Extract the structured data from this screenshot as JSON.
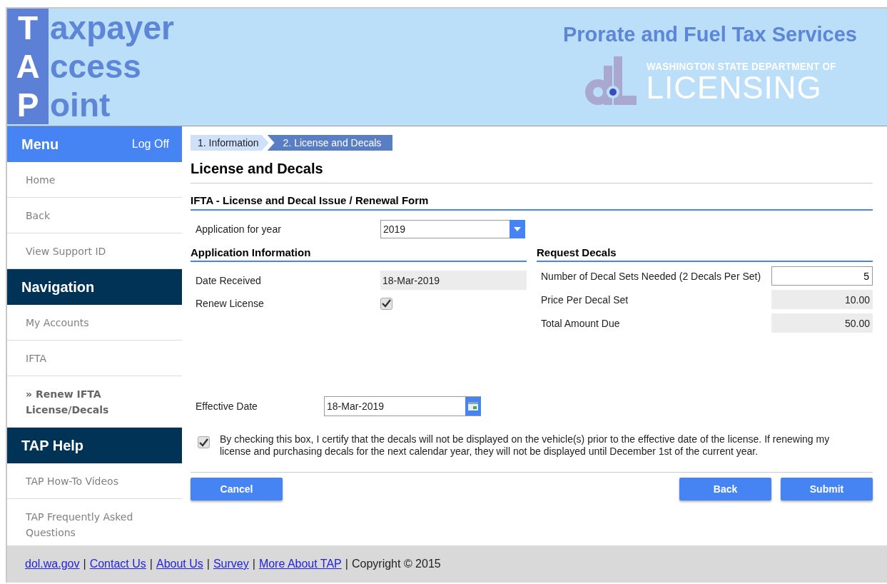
{
  "header": {
    "logo_lines": [
      {
        "initial": "T",
        "rest": "axpayer"
      },
      {
        "initial": "A",
        "rest": "ccess"
      },
      {
        "initial": "P",
        "rest": "oint"
      }
    ],
    "service_title": "Prorate and Fuel Tax Services",
    "agency_line": "WASHINGTON STATE DEPARTMENT OF",
    "agency_name": "LICENSING"
  },
  "sidebar": {
    "items": [
      {
        "kind": "header",
        "label": "Menu",
        "link": "Log Off"
      },
      {
        "kind": "item",
        "label": "Home",
        "selected": false
      },
      {
        "kind": "item",
        "label": "Back",
        "selected": false
      },
      {
        "kind": "item",
        "label": "View Support ID",
        "selected": false
      },
      {
        "kind": "section",
        "label": "Navigation"
      },
      {
        "kind": "item",
        "label": "My Accounts",
        "selected": false
      },
      {
        "kind": "item",
        "label": "IFTA",
        "selected": false
      },
      {
        "kind": "item",
        "label": "» Renew IFTA License/Decals",
        "selected": true
      },
      {
        "kind": "section",
        "label": "TAP Help"
      },
      {
        "kind": "item",
        "label": "TAP How-To Videos",
        "selected": false
      },
      {
        "kind": "item",
        "label": "TAP Frequently Asked Questions",
        "selected": false
      }
    ]
  },
  "steps": [
    {
      "label": "1. Information",
      "selected": false
    },
    {
      "label": "2. License and Decals",
      "selected": true
    }
  ],
  "page_title": "License and Decals",
  "form_title": "IFTA - License and Decal Issue / Renewal Form",
  "application_year": {
    "label": "Application for year",
    "value": "2019"
  },
  "application_info": {
    "title": "Application Information",
    "date_received": {
      "label": "Date Received",
      "value": "18-Mar-2019"
    },
    "renew_license": {
      "label": "Renew License",
      "checked": true
    }
  },
  "request_decals": {
    "title": "Request Decals",
    "rows": [
      {
        "kind": "input",
        "label": "Number of Decal Sets Needed (2 Decals Per Set)",
        "value": "5"
      },
      {
        "kind": "readonly",
        "label": "Price Per Decal Set",
        "value": "10.00"
      },
      {
        "kind": "readonly",
        "label": "Total Amount Due",
        "value": "50.00"
      }
    ]
  },
  "effective_date": {
    "label": "Effective Date",
    "value": "18-Mar-2019"
  },
  "certification": {
    "checked": true,
    "text": "By checking this box, I certify that the decals will not be displayed on the vehicle(s) prior to the effective date of the license. If renewing my license and purchasing decals for the next calendar year, they will not be displayed until December 1st of the current year."
  },
  "buttons": {
    "left": [
      "Cancel"
    ],
    "right": [
      "Back",
      "Submit"
    ]
  },
  "footer": {
    "items": [
      {
        "kind": "link",
        "text": "dol.wa.gov"
      },
      {
        "kind": "separator",
        "text": "|"
      },
      {
        "kind": "link",
        "text": "Contact Us"
      },
      {
        "kind": "separator",
        "text": "|"
      },
      {
        "kind": "link",
        "text": "About Us"
      },
      {
        "kind": "separator",
        "text": "|"
      },
      {
        "kind": "link",
        "text": "Survey"
      },
      {
        "kind": "separator",
        "text": "|"
      },
      {
        "kind": "link",
        "text": "More About TAP"
      },
      {
        "kind": "separator",
        "text": "|"
      },
      {
        "kind": "text",
        "text": "Copyright © 2015"
      }
    ]
  }
}
